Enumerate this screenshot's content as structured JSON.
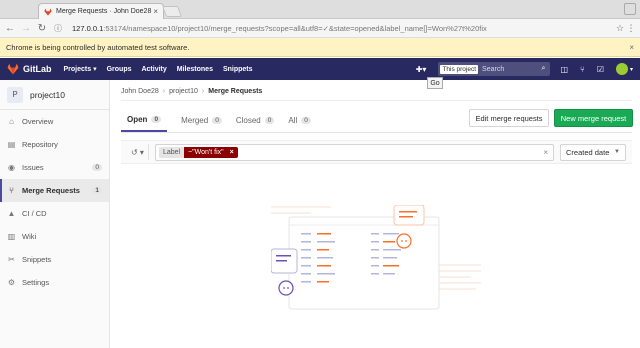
{
  "browser": {
    "tab_title": "Merge Requests · John Doe28",
    "url_host": "127.0.0.1",
    "url_rest": ":53174/namespace10/project10/merge_requests?scope=all&utf8=✓&state=opened&label_name[]=Won%27t%20fix",
    "infobar_text": "Chrome is being controlled by automated test software."
  },
  "header": {
    "logo_text": "GitLab",
    "nav": [
      "Projects ▾",
      "Groups",
      "Activity",
      "Milestones",
      "Snippets"
    ],
    "search_scope": "This project",
    "search_placeholder": "Search",
    "go_tooltip": "Go",
    "brand_color": "#292961"
  },
  "sidebar": {
    "project_initial": "P",
    "project_name": "project10",
    "items": [
      {
        "label": "Overview",
        "icon": "home-icon"
      },
      {
        "label": "Repository",
        "icon": "doc-icon"
      },
      {
        "label": "Issues",
        "icon": "issues-icon",
        "count": "0"
      },
      {
        "label": "Merge Requests",
        "icon": "merge-request-icon",
        "count": "1"
      },
      {
        "label": "CI / CD",
        "icon": "rocket-icon"
      },
      {
        "label": "Wiki",
        "icon": "book-icon"
      },
      {
        "label": "Snippets",
        "icon": "scissors-icon"
      },
      {
        "label": "Settings",
        "icon": "gear-icon"
      }
    ]
  },
  "breadcrumb": {
    "user": "John Doe28",
    "project": "project10",
    "current": "Merge Requests"
  },
  "tabs": [
    {
      "label": "Open",
      "count": "0"
    },
    {
      "label": "Merged",
      "count": "0"
    },
    {
      "label": "Closed",
      "count": "0"
    },
    {
      "label": "All",
      "count": "0"
    }
  ],
  "buttons": {
    "edit": "Edit merge requests",
    "new": "New merge request",
    "new_color": "#1aaa55"
  },
  "filter": {
    "token_name": "Label",
    "token_value": "~\"Won't fix\"",
    "token_remove": "×",
    "token_color": "#8b0000",
    "clear": "×",
    "sort": "Created date"
  }
}
